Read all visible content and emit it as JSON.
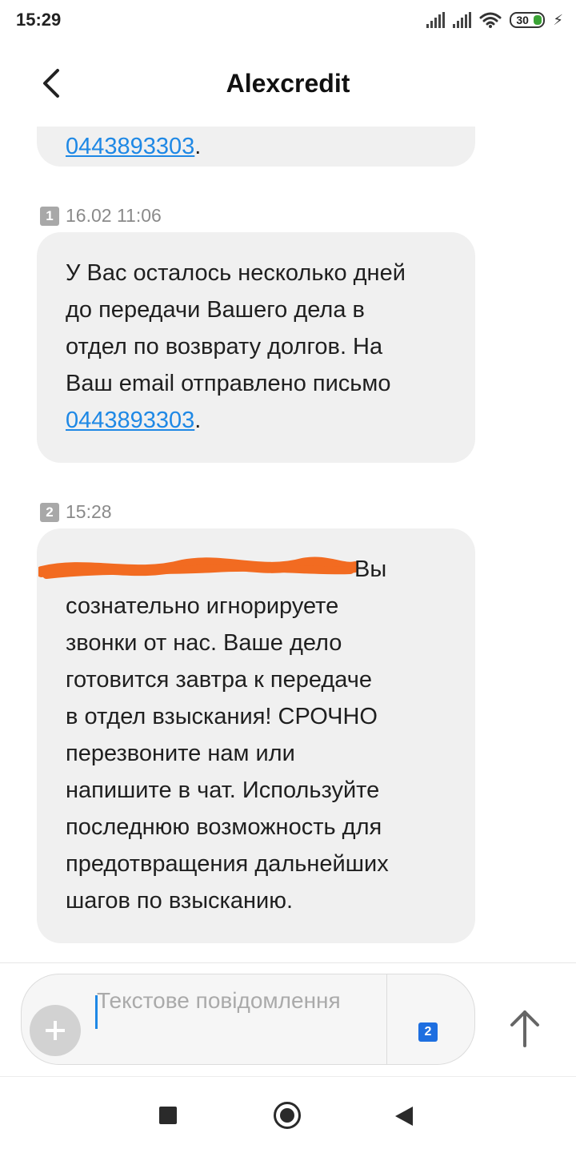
{
  "status_bar": {
    "time": "15:29",
    "battery": "30"
  },
  "header": {
    "title": "Alexcredit",
    "back_icon": "chevron-left-icon"
  },
  "messages": [
    {
      "partial_link": "0443893303",
      "partial_trailing": "."
    },
    {
      "sim": "1",
      "timestamp": "16.02 11:06",
      "lines": [
        "У Вас осталось несколько дней",
        "до передачи Вашего дела в",
        "отдел по возврату долгов. На",
        "Ваш email отправлено письмо"
      ],
      "link": "0443893303",
      "trailing": "."
    },
    {
      "sim": "2",
      "timestamp": "15:28",
      "first_line_visible": "Вы",
      "lines": [
        "сознательно игнорируете",
        "звонки от нас. Ваше дело",
        "готовится завтра к передаче",
        "в отдел взыскания! СРОЧНО",
        "перезвоните нам или",
        "напишите в чат. Используйте",
        "последнюю возможность для",
        "предотвращения дальнейших",
        "шагов по взысканию."
      ]
    }
  ],
  "composer": {
    "placeholder": "Текстове повідомлення",
    "sim_selector": "2",
    "attach_icon": "plus-icon",
    "send_icon": "arrow-up-icon"
  },
  "nav": {
    "recents_icon": "square-icon",
    "home_icon": "circle-icon",
    "back_icon": "triangle-back-icon"
  },
  "colors": {
    "link": "#1e88e5",
    "bubble": "#f0f0f0",
    "redaction": "#f26b21",
    "sim_selected": "#1e6fe0"
  }
}
